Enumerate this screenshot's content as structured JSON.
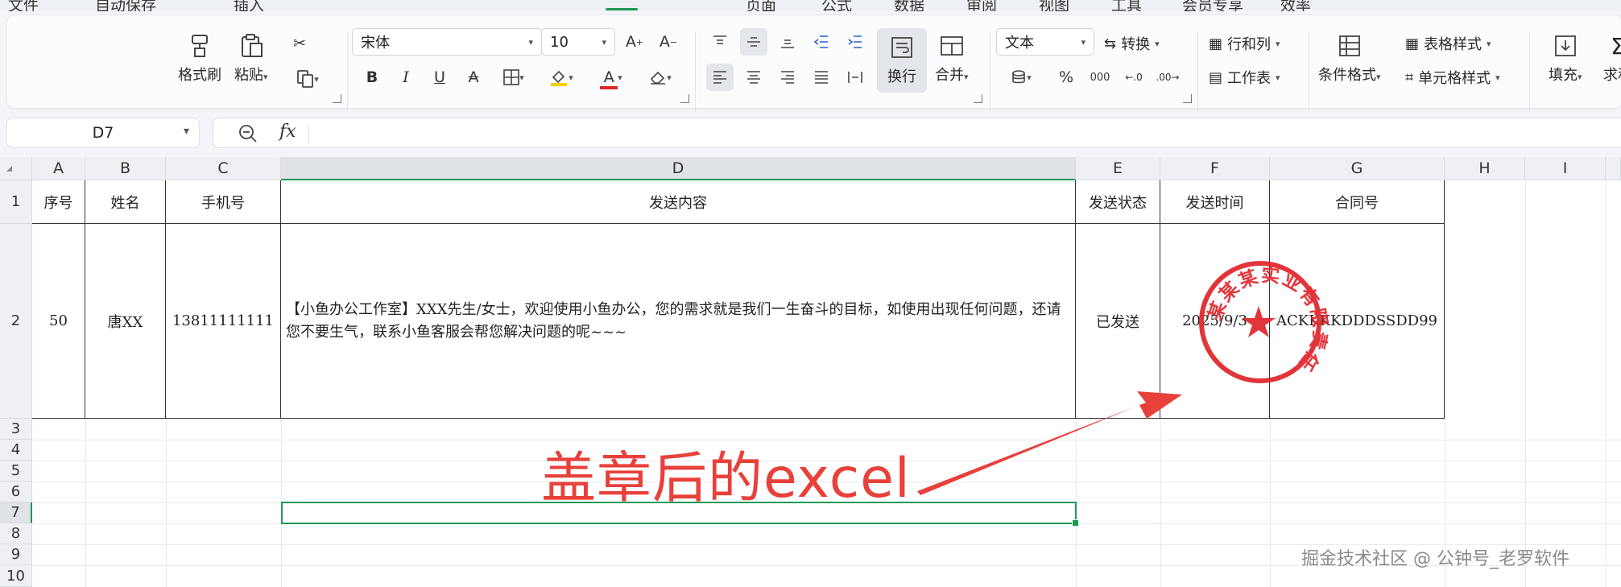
{
  "menu": {
    "items": [
      "文件",
      "自动保存",
      "插入",
      "页面",
      "公式",
      "数据",
      "审阅",
      "视图",
      "工具",
      "会员专享",
      "效率"
    ],
    "active_index": 2
  },
  "ribbon": {
    "format_painter": "格式刷",
    "paste": "粘贴",
    "font_name": "宋体",
    "font_size": "10",
    "bold": "B",
    "italic": "I",
    "underline": "U",
    "wrap_text": "换行",
    "merge": "合并",
    "number_format": "文本",
    "convert": "转换",
    "percent": "%",
    "thousands": "000",
    "rows_cols": "行和列",
    "worksheet": "工作表",
    "conditional_format": "条件格式",
    "table_style": "表格样式",
    "cell_style": "单元格样式",
    "fill": "填充",
    "sum": "求和"
  },
  "formula_bar": {
    "cell_ref": "D7",
    "fx": "fx",
    "content": ""
  },
  "columns": [
    "A",
    "B",
    "C",
    "D",
    "E",
    "F",
    "G",
    "H",
    "I"
  ],
  "selected_column": "D",
  "rows": [
    "1",
    "2",
    "3",
    "4",
    "5",
    "6",
    "7",
    "8",
    "9",
    "10"
  ],
  "selected_row": "7",
  "table": {
    "headers": [
      "序号",
      "姓名",
      "手机号",
      "发送内容",
      "发送状态",
      "发送时间",
      "合同号"
    ],
    "row": [
      "50",
      "唐XX",
      "13811111111",
      "【小鱼办公工作室】XXX先生/女士，欢迎使用小鱼办公，您的需求就是我们一生奋斗的目标，如使用出现任何问题，还请您不要生气，联系小鱼客服会帮您解决问题的呢~~~",
      "已发送",
      "2025/9/3",
      "ACKKKKDDDSSDD99"
    ]
  },
  "seal": {
    "text": "某某某实业有限责任公司",
    "color": "#e0242a"
  },
  "annotation": {
    "text": "盖章后的excel",
    "color": "#e8403b"
  },
  "watermark": "掘金技术社区 @ 公钟号_老罗软件",
  "accent_color": "#1f9a55"
}
